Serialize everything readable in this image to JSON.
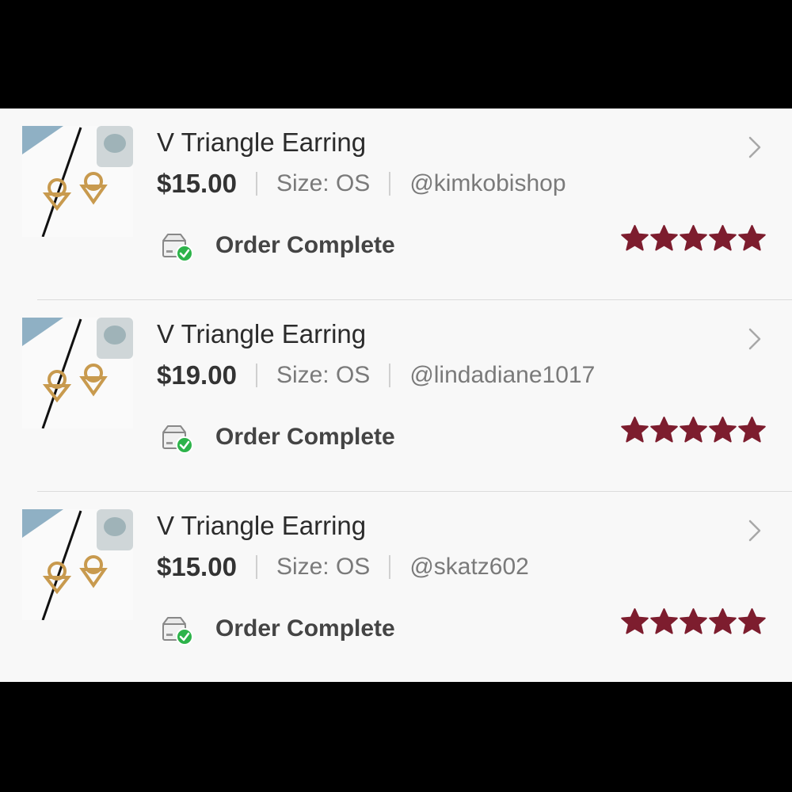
{
  "colors": {
    "star": "#7d1d2e",
    "check_badge": "#2db34a",
    "divider": "#dcdcdc",
    "background": "#f8f8f8"
  },
  "orders": [
    {
      "title": "V Triangle Earring",
      "price": "$15.00",
      "size": "Size: OS",
      "seller": "@kimkobishop",
      "status": "Order Complete",
      "rating": 5,
      "thumbnail_icon": "gold-v-triangle-earrings-photo"
    },
    {
      "title": "V Triangle Earring",
      "price": "$19.00",
      "size": "Size: OS",
      "seller": "@lindadiane1017",
      "status": "Order Complete",
      "rating": 5,
      "thumbnail_icon": "gold-v-triangle-earrings-photo"
    },
    {
      "title": "V Triangle Earring",
      "price": "$15.00",
      "size": "Size: OS",
      "seller": "@skatz602",
      "status": "Order Complete",
      "rating": 5,
      "thumbnail_icon": "gold-v-triangle-earrings-photo"
    }
  ]
}
